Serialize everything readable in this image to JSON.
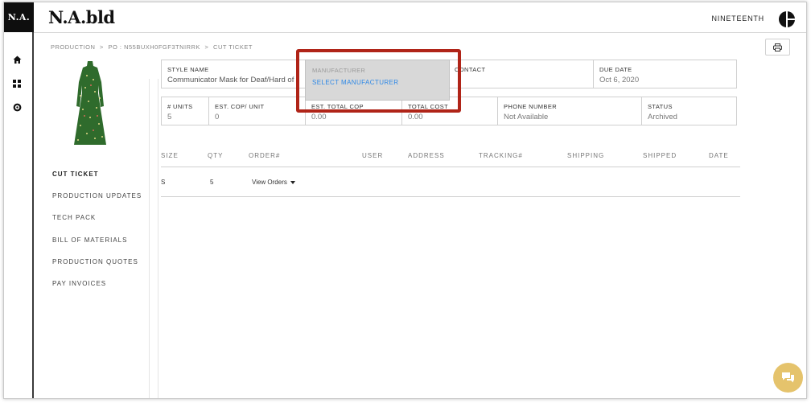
{
  "app": {
    "logo_text": "N.A.",
    "brand": "N.A.bld",
    "account_name": "NINETEENTH"
  },
  "rail": {
    "icons": [
      "home-icon",
      "grid-icon",
      "gear-icon"
    ]
  },
  "breadcrumb": {
    "items": [
      "PRODUCTION",
      ">",
      "PO : N55BUXH0FGF3TNIRRK",
      ">",
      "CUT TICKET"
    ]
  },
  "sidenav": {
    "items": [
      {
        "label": "CUT TICKET",
        "active": true
      },
      {
        "label": "PRODUCTION UPDATES",
        "active": false
      },
      {
        "label": "TECH PACK",
        "active": false
      },
      {
        "label": "BILL OF MATERIALS",
        "active": false
      },
      {
        "label": "PRODUCTION QUOTES",
        "active": false
      },
      {
        "label": "PAY INVOICES",
        "active": false
      }
    ]
  },
  "details": {
    "style_name": {
      "label": "STYLE NAME",
      "value": "Communicator Mask for Deaf/Hard of H"
    },
    "manufacturer": {
      "label": "MANUFACTURER",
      "action": "SELECT MANUFACTURER"
    },
    "contact": {
      "label": "CONTACT",
      "value": ""
    },
    "due_date": {
      "label": "DUE DATE",
      "value": "Oct 6, 2020"
    },
    "units": {
      "label": "# UNITS",
      "value": "5"
    },
    "est_cop_unit": {
      "label": "EST. COP/ UNIT",
      "value": "0"
    },
    "est_total_cop": {
      "label": "EST. TOTAL COP",
      "value": "0.00"
    },
    "total_cost": {
      "label": "TOTAL COST",
      "value": "0.00"
    },
    "phone": {
      "label": "PHONE NUMBER",
      "value": "Not Available"
    },
    "status": {
      "label": "STATUS",
      "value": "Archived"
    }
  },
  "table": {
    "headers": [
      "SIZE",
      "QTY",
      "ORDER#",
      "USER",
      "ADDRESS",
      "TRACKING#",
      "SHIPPING",
      "SHIPPED",
      "DATE"
    ],
    "rows": [
      {
        "size": "S",
        "qty": "5",
        "orders_label": "View Orders"
      }
    ]
  },
  "colors": {
    "highlight": "#b02418",
    "link": "#2e88e6",
    "chat": "#e5c36c",
    "dress": "#2f6b2c"
  }
}
